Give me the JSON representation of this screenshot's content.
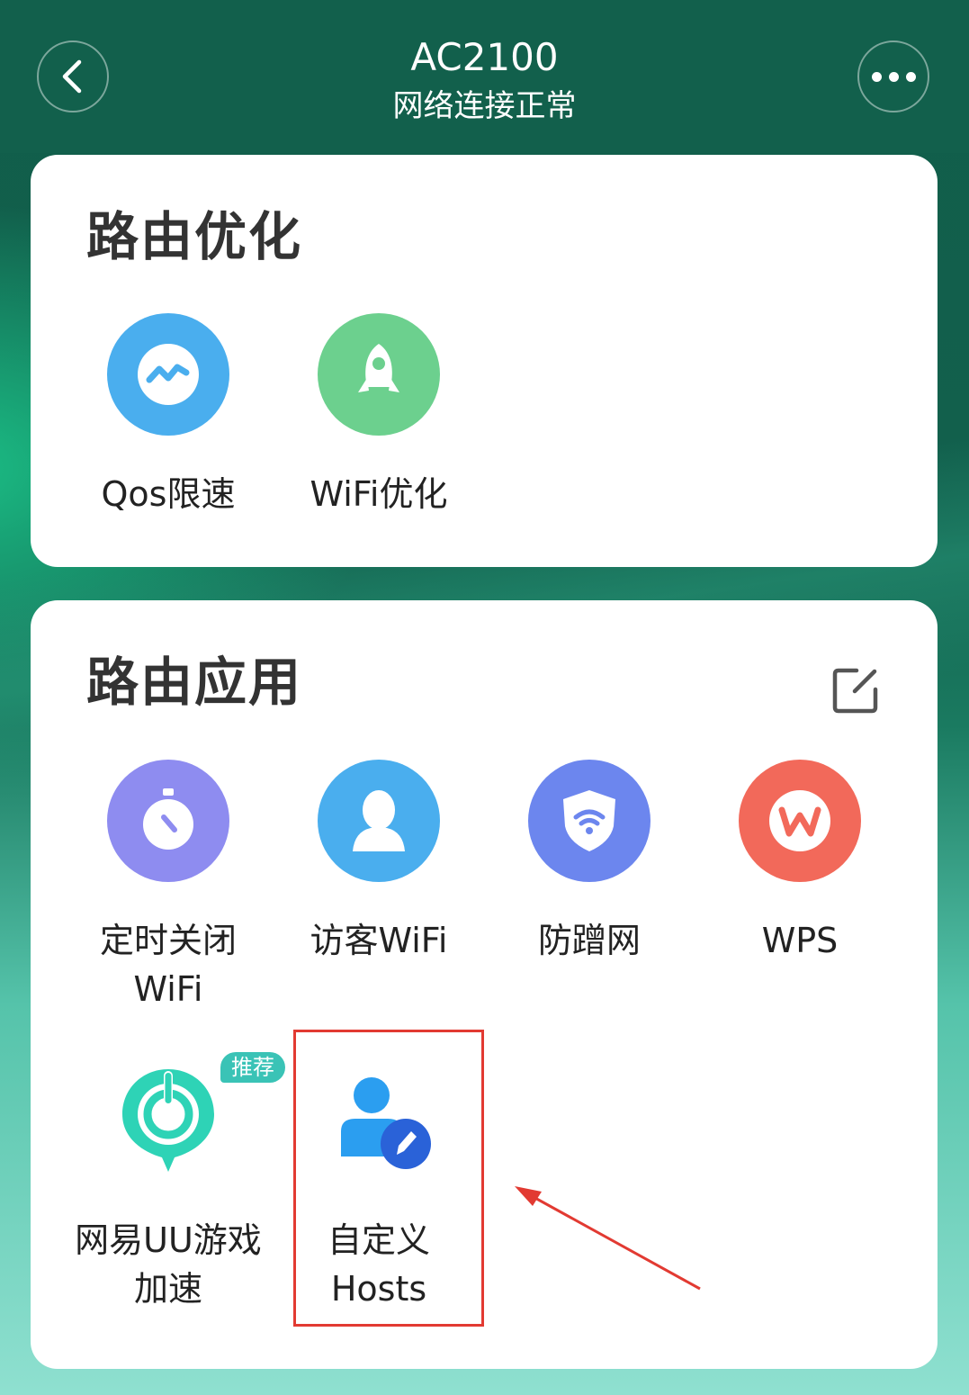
{
  "header": {
    "title": "AC2100",
    "subtitle": "网络连接正常",
    "back_icon": "chevron-left-icon",
    "more_icon": "more-dots-icon"
  },
  "optimize": {
    "title": "路由优化",
    "items": [
      {
        "label": "Qos限速",
        "icon": "speed-chart-icon",
        "color": "#4aaeee"
      },
      {
        "label": "WiFi优化",
        "icon": "rocket-icon",
        "color": "#6cd08e"
      }
    ]
  },
  "apps": {
    "title": "路由应用",
    "edit_icon": "edit-icon",
    "items": [
      {
        "label": "定时关闭\nWiFi",
        "icon": "timer-icon",
        "color": "#8e8cf0"
      },
      {
        "label": "访客WiFi",
        "icon": "guest-user-icon",
        "color": "#4aaeee"
      },
      {
        "label": "防蹭网",
        "icon": "wifi-shield-icon",
        "color": "#6c86ee"
      },
      {
        "label": "WPS",
        "icon": "wps-icon",
        "color": "#f2695a"
      },
      {
        "label": "网易UU游戏\n加速",
        "icon": "uu-accelerator-icon",
        "color": "#2ed3b6",
        "badge": "推荐"
      },
      {
        "label": "自定义\nHosts",
        "icon": "custom-hosts-icon",
        "color": "#2b9ef0"
      }
    ]
  },
  "colors": {
    "header_bg": "#12604c",
    "highlight": "#e23a32"
  }
}
